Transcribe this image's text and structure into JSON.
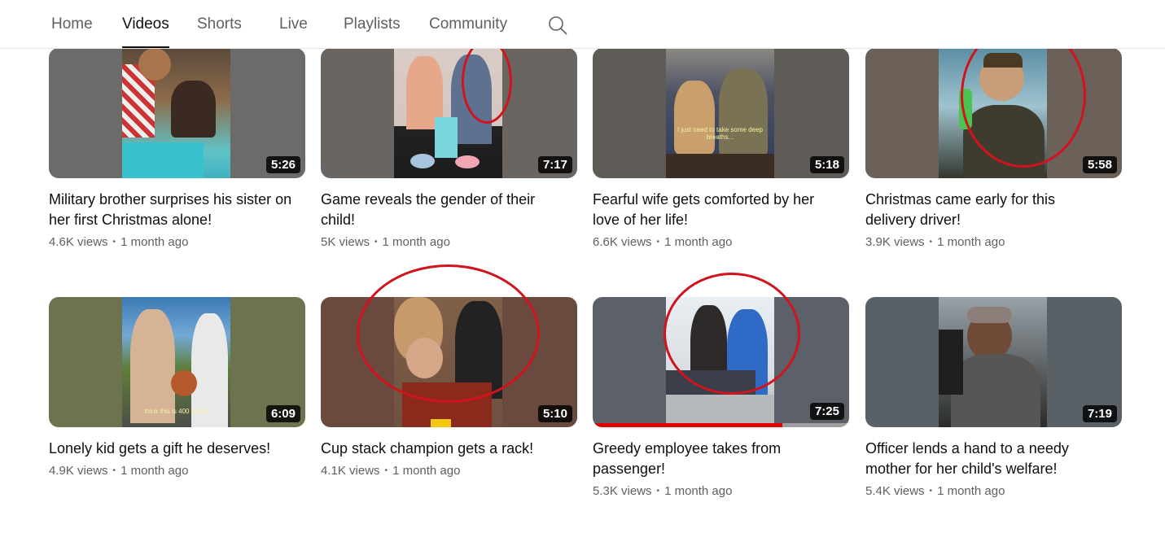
{
  "tabs": [
    {
      "label": "Home",
      "active": false
    },
    {
      "label": "Videos",
      "active": true
    },
    {
      "label": "Shorts",
      "active": false
    },
    {
      "label": "Live",
      "active": false
    },
    {
      "label": "Playlists",
      "active": false
    },
    {
      "label": "Community",
      "active": false
    }
  ],
  "search_icon": "search-icon",
  "videos": [
    {
      "title": "Military brother surprises his sister on her first Christmas alone!",
      "views": "4.6K views",
      "age": "1 month ago",
      "duration": "5:26"
    },
    {
      "title": "Game reveals the gender of their child!",
      "views": "5K views",
      "age": "1 month ago",
      "duration": "7:17"
    },
    {
      "title": "Fearful wife gets comforted by her love of her life!",
      "views": "6.6K views",
      "age": "1 month ago",
      "duration": "5:18",
      "caption": "I just need to take some deep breaths..."
    },
    {
      "title": "Christmas came early for this delivery driver!",
      "views": "3.9K views",
      "age": "1 month ago",
      "duration": "5:58"
    },
    {
      "title": "Lonely kid gets a gift he deserves!",
      "views": "4.9K views",
      "age": "1 month ago",
      "duration": "6:09",
      "caption": "think this is 400 bucks"
    },
    {
      "title": "Cup stack champion gets a rack!",
      "views": "4.1K views",
      "age": "1 month ago",
      "duration": "5:10"
    },
    {
      "title": "Greedy employee takes from passenger!",
      "views": "5.3K views",
      "age": "1 month ago",
      "duration": "7:25",
      "watch_progress": 0.74
    },
    {
      "title": "Officer lends a hand to a needy mother for her child's welfare!",
      "views": "5.4K views",
      "age": "1 month ago",
      "duration": "7:19"
    }
  ],
  "colors": {
    "annotation": "#d0131d",
    "progress": "#e00000",
    "meta_text": "#606060"
  }
}
